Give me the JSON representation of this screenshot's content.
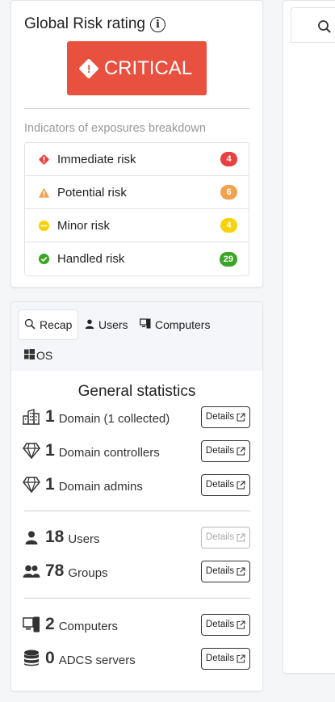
{
  "risk": {
    "title": "Global Risk rating",
    "info_icon": "info-icon",
    "level": "CRITICAL",
    "level_color": "#e8503f",
    "indicators_label": "Indicators of exposures breakdown",
    "items": [
      {
        "label": "Immediate risk",
        "count": "4",
        "color": "#e8413f",
        "icon": "exclamation-diamond-icon"
      },
      {
        "label": "Potential risk",
        "count": "6",
        "color": "#f0a24e",
        "icon": "warning-triangle-icon"
      },
      {
        "label": "Minor risk",
        "count": "4",
        "color": "#f7d20c",
        "icon": "minus-circle-icon"
      },
      {
        "label": "Handled risk",
        "count": "29",
        "color": "#3aa424",
        "icon": "check-circle-icon"
      }
    ]
  },
  "tabs": [
    {
      "label": "Recap",
      "icon": "search-icon",
      "active": true
    },
    {
      "label": "Users",
      "icon": "user-icon"
    },
    {
      "label": "Computers",
      "icon": "computers-icon"
    },
    {
      "label": "OS",
      "icon": "windows-icon"
    }
  ],
  "stats": {
    "title": "General statistics",
    "details_label": "Details",
    "rows": [
      {
        "num": "1",
        "label": "Domain (1 collected)",
        "icon": "building-icon",
        "details_enabled": true
      },
      {
        "num": "1",
        "label": "Domain controllers",
        "icon": "diamond-icon",
        "details_enabled": true
      },
      {
        "num": "1",
        "label": "Domain admins",
        "icon": "diamond-icon",
        "details_enabled": true
      },
      {
        "num": "18",
        "label": "Users",
        "icon": "user-icon",
        "details_enabled": false
      },
      {
        "num": "78",
        "label": "Groups",
        "icon": "users-icon",
        "details_enabled": true
      },
      {
        "num": "2",
        "label": "Computers",
        "icon": "computers-icon",
        "details_enabled": true
      },
      {
        "num": "0",
        "label": "ADCS servers",
        "icon": "database-icon",
        "details_enabled": true
      }
    ]
  }
}
